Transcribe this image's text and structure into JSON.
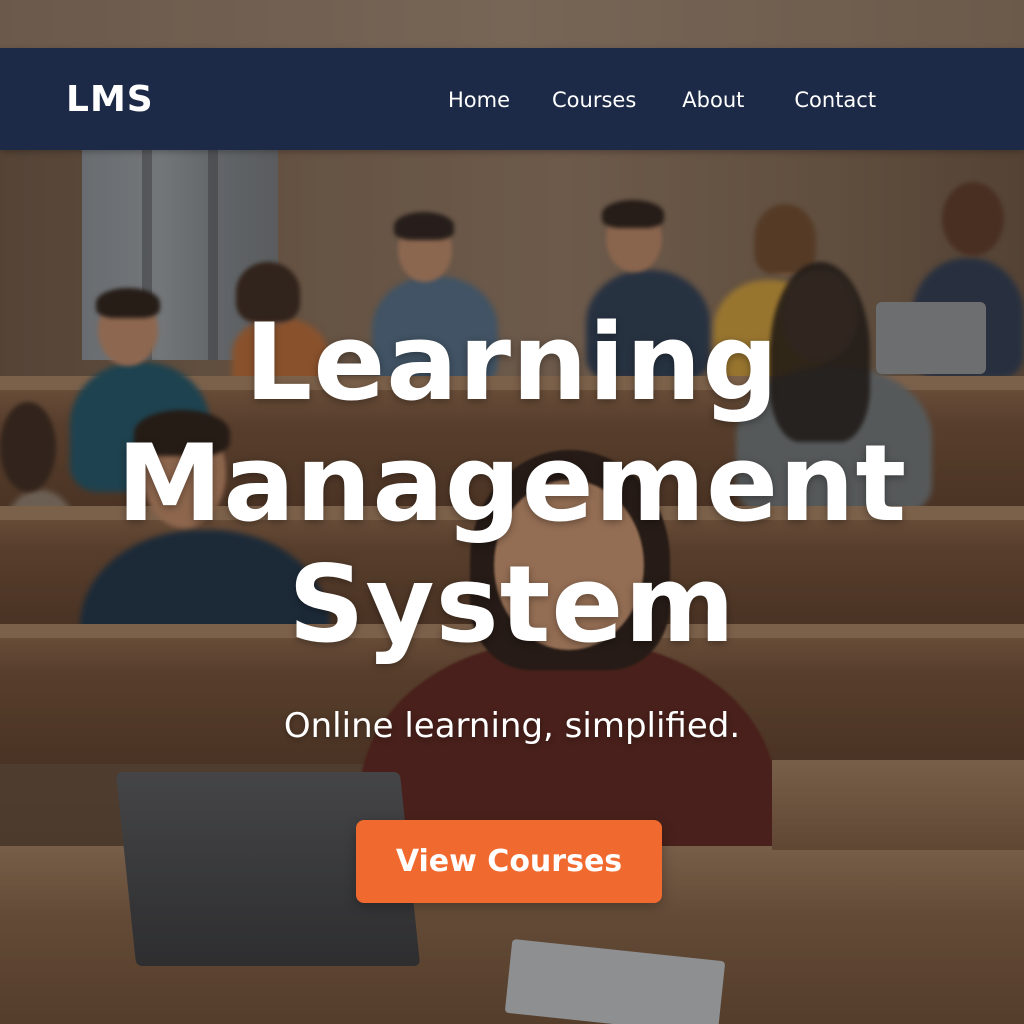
{
  "nav": {
    "logo": "LMS",
    "links": [
      "Home",
      "Courses",
      "About",
      "Contact"
    ]
  },
  "hero": {
    "title_lines": [
      "Learning",
      "Management",
      "System"
    ],
    "subtitle": "Online learning, simplified.",
    "cta_label": "View Courses"
  },
  "colors": {
    "nav_background": "#1d2a47",
    "cta_background": "#f0692f",
    "text": "#ffffff"
  }
}
